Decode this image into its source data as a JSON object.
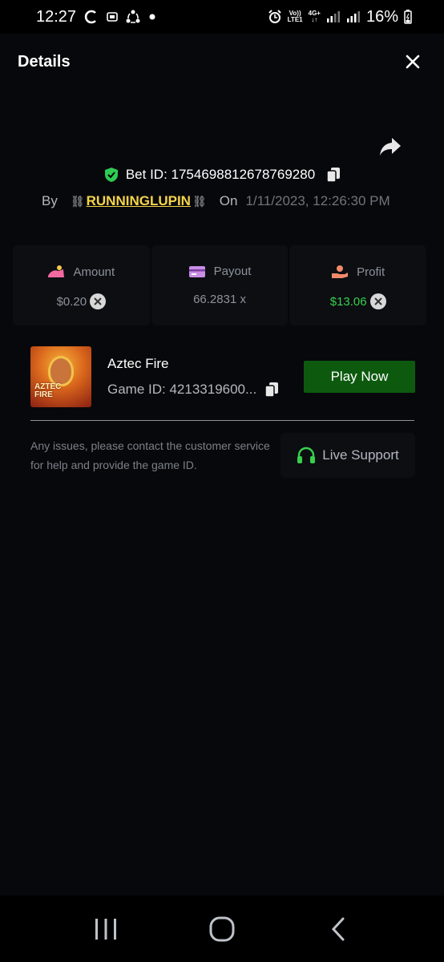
{
  "status_bar": {
    "time": "12:27",
    "battery": "16%",
    "network_top": "Vo))",
    "network_bottom": "LTE1",
    "network_type": "4G+",
    "icons": [
      "sync-icon",
      "image-icon",
      "share-circle-icon",
      "dot-icon",
      "alarm-icon",
      "signal-icon",
      "signal-icon",
      "battery-icon"
    ]
  },
  "header": {
    "title": "Details"
  },
  "bet": {
    "label": "Bet ID: 1754698812678769280",
    "by_label": "By",
    "chain_left": "⛓",
    "username": "RUNNINGLUPIN",
    "chain_right": "⛓",
    "on_label": "On",
    "date": "1/11/2023, 12:26:30 PM"
  },
  "stats": {
    "amount": {
      "label": "Amount",
      "value": "$0.20"
    },
    "payout": {
      "label": "Payout",
      "value": "66.2831 x"
    },
    "profit": {
      "label": "Profit",
      "value": "$13.06"
    }
  },
  "game": {
    "thumbnail_text_1": "AZTEC",
    "thumbnail_text_2": "FIRE",
    "name": "Aztec Fire",
    "id_label": "Game ID: 4213319600...",
    "play_label": "Play Now"
  },
  "support": {
    "text": "Any issues, please contact the customer service for help and provide the game ID.",
    "button_label": "Live Support"
  },
  "colors": {
    "background": "#07080b",
    "accent_green": "#0d5a0f",
    "profit_green": "#37d04c",
    "username_yellow": "#f5d44a",
    "shield_green": "#2ecb54"
  }
}
